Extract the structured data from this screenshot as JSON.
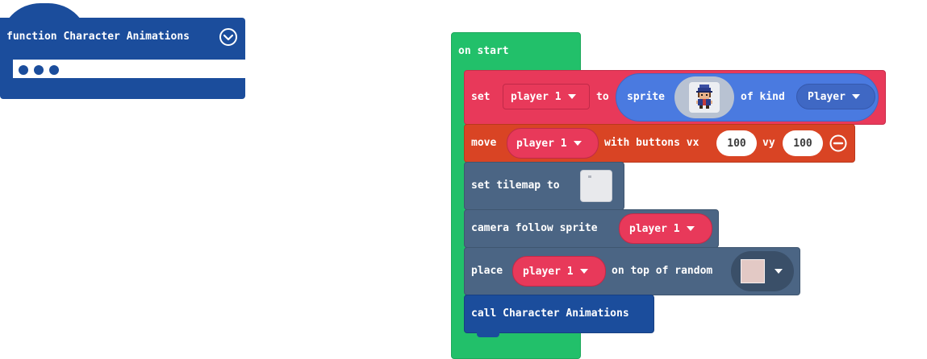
{
  "colors": {
    "function_blue": "#1b4d9c",
    "events_green": "#22c06a",
    "sprites_red": "#e8395a",
    "sprites_blue": "#4a7ae0",
    "controller_orange": "#d94424",
    "scene_slate": "#4b6584"
  },
  "function_block": {
    "title": "function Character Animations",
    "collapse_icon": "chevron-down-circle-icon",
    "dots_icon": "ellipsis-icon"
  },
  "on_start": {
    "label": "on start",
    "blocks": {
      "set_sprite": {
        "set_label": "set",
        "variable": "player 1",
        "to_label": "to",
        "sprite_label": "sprite",
        "image_icon": "sprite-image-icon",
        "of_kind_label": "of kind",
        "kind": "Player"
      },
      "move": {
        "label": "move",
        "variable": "player 1",
        "with_buttons_label": "with buttons vx",
        "vx": "100",
        "vy_label": "vy",
        "vy": "100",
        "remove_icon": "minus-circle-icon"
      },
      "set_tilemap": {
        "label": "set tilemap to",
        "tilemap_icon": "tilemap-thumbnail-icon"
      },
      "camera": {
        "label": "camera follow sprite",
        "variable": "player 1"
      },
      "place": {
        "label": "place",
        "variable": "player 1",
        "on_top_label": "on top of random",
        "tile_icon": "tile-swatch-icon",
        "tile_color": "#e3c9c5"
      },
      "call": {
        "label": "call Character Animations"
      }
    }
  }
}
